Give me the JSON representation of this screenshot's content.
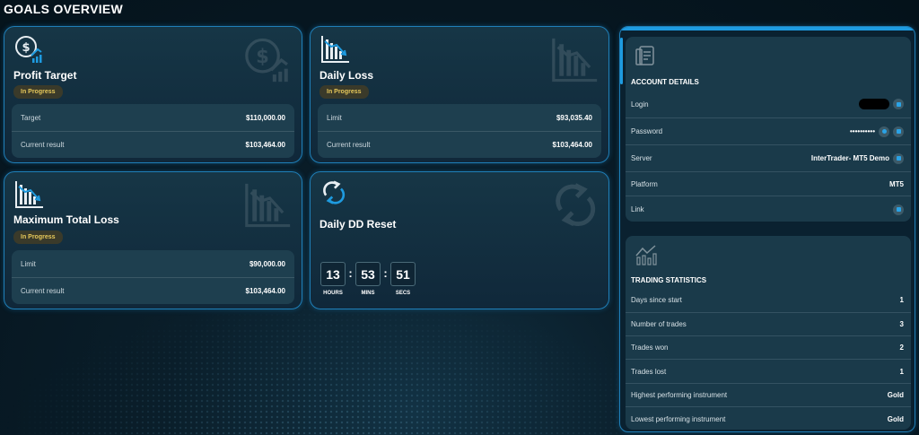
{
  "page": {
    "title": "GOALS OVERVIEW"
  },
  "colors": {
    "accent": "#1e9be0",
    "badge_bg": "#3a3a2a",
    "badge_text": "#e6c85a",
    "card_border": "#1f7fb8"
  },
  "cards": {
    "profit_target": {
      "icon": "dollar-chart-icon",
      "title": "Profit Target",
      "status": "In Progress",
      "rows": [
        {
          "label": "Target",
          "value": "$110,000.00"
        },
        {
          "label": "Current result",
          "value": "$103,464.00"
        }
      ]
    },
    "daily_loss": {
      "icon": "chart-down-icon",
      "title": "Daily Loss",
      "status": "In Progress",
      "rows": [
        {
          "label": "Limit",
          "value": "$93,035.40"
        },
        {
          "label": "Current result",
          "value": "$103,464.00"
        }
      ]
    },
    "max_total_loss": {
      "icon": "chart-down-icon",
      "title": "Maximum Total Loss",
      "status": "In Progress",
      "rows": [
        {
          "label": "Limit",
          "value": "$90,000.00"
        },
        {
          "label": "Current result",
          "value": "$103,464.00"
        }
      ]
    },
    "daily_dd_reset": {
      "icon": "refresh-icon",
      "title": "Daily DD Reset",
      "timer": {
        "hours": "13",
        "minutes": "53",
        "seconds": "51",
        "hours_label": "HOURS",
        "minutes_label": "MINS",
        "seconds_label": "SECS",
        "separator": ":"
      }
    }
  },
  "account": {
    "icon": "document-icon",
    "title": "ACCOUNT DETAILS",
    "login": {
      "label": "Login"
    },
    "password": {
      "label": "Password",
      "value": "••••••••••"
    },
    "server": {
      "label": "Server",
      "value": "InterTrader- MT5 Demo"
    },
    "platform": {
      "label": "Platform",
      "value": "MT5"
    },
    "link": {
      "label": "Link"
    }
  },
  "stats": {
    "icon": "bar-chart-icon",
    "title": "TRADING STATISTICS",
    "rows": [
      {
        "label": "Days since start",
        "value": "1"
      },
      {
        "label": "Number of trades",
        "value": "3"
      },
      {
        "label": "Trades won",
        "value": "2"
      },
      {
        "label": "Trades lost",
        "value": "1"
      },
      {
        "label": "Highest performing instrument",
        "value": "Gold"
      },
      {
        "label": "Lowest performing instrument",
        "value": "Gold"
      }
    ]
  }
}
